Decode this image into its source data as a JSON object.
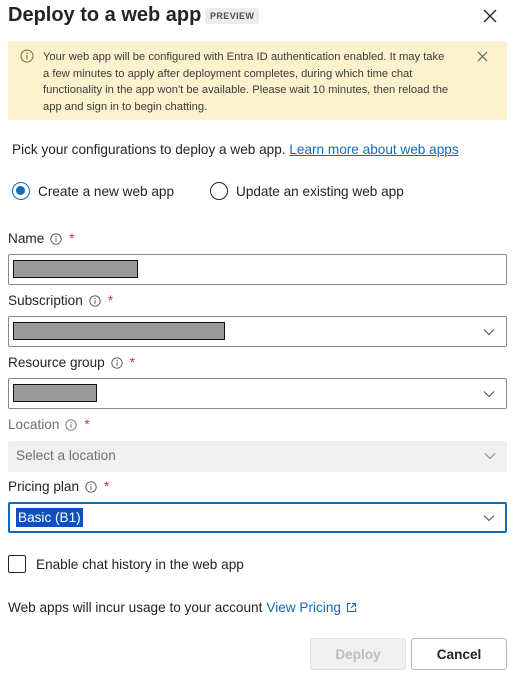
{
  "dialog": {
    "title": "Deploy to a web app",
    "badge": "PREVIEW"
  },
  "banner": {
    "text": "Your web app will be configured with Entra ID authentication enabled. It may take a few minutes to apply after deployment completes, during which time chat functionality in the app won't be available. Please wait 10 minutes, then reload the app and sign in to begin chatting."
  },
  "intro": {
    "text": "Pick your configurations to deploy a web app.",
    "link": "Learn more about web apps"
  },
  "mode": {
    "options": [
      {
        "label": "Create a new web app",
        "selected": true
      },
      {
        "label": "Update an existing web app",
        "selected": false
      }
    ]
  },
  "fields": {
    "name": {
      "label": "Name",
      "required": "*"
    },
    "subscription": {
      "label": "Subscription",
      "required": "*"
    },
    "resource_group": {
      "label": "Resource group",
      "required": "*"
    },
    "location": {
      "label": "Location",
      "required": "*",
      "placeholder": "Select a location",
      "disabled": true
    },
    "pricing_plan": {
      "label": "Pricing plan",
      "required": "*",
      "value": "Basic (B1)"
    }
  },
  "chat_history": {
    "label": "Enable chat history in the web app",
    "checked": false
  },
  "usage": {
    "text": "Web apps will incur usage to your account",
    "link": "View Pricing"
  },
  "buttons": {
    "deploy": "Deploy",
    "cancel": "Cancel"
  },
  "colors": {
    "accent": "#0f6cbd",
    "banner_bg": "#fcf2ce",
    "required": "#c4314b"
  }
}
